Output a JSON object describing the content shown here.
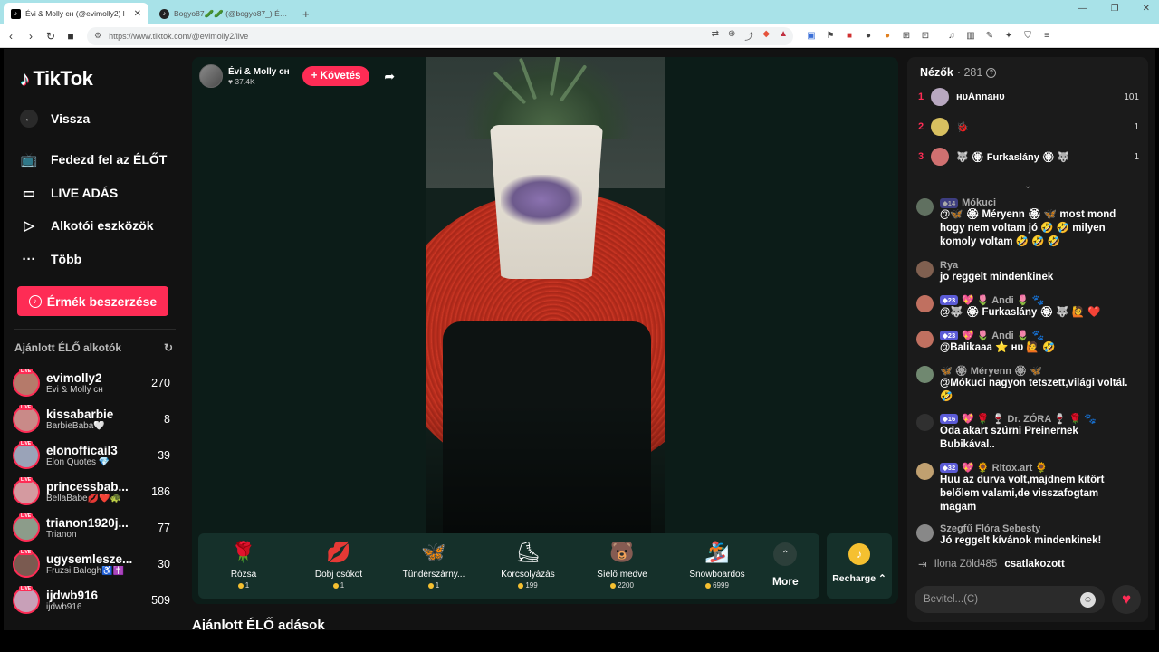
{
  "browser": {
    "tabs": [
      {
        "title": "Évi & Molly ᴄʜ (@evimolly2) l",
        "active": true
      },
      {
        "title": "Bogyo87🥒🥒 (@bogyo87_) ÉLŐ ad",
        "active": false
      }
    ],
    "url": "https://www.tiktok.com/@evimolly2/live"
  },
  "sidebar": {
    "logo": "TikTok",
    "back": "Vissza",
    "nav": [
      "Fedezd fel az ÉLŐT",
      "LIVE ADÁS",
      "Alkotói eszközök",
      "Több"
    ],
    "coins_button": "Érmék beszerzése",
    "recommended_title": "Ajánlott ÉLŐ alkotók",
    "live_badge": "LIVE",
    "creators": [
      {
        "name": "evimolly2",
        "sub": "Évi & Molly ᴄʜ",
        "count": "270",
        "color": "#b57a6a"
      },
      {
        "name": "kissabarbie",
        "sub": "BarbieBaba🤍",
        "count": "8",
        "color": "#c98a88"
      },
      {
        "name": "elonofficail3",
        "sub": "Elon Quotes 💎",
        "count": "39",
        "color": "#9aa3b8"
      },
      {
        "name": "princessbab...",
        "sub": "BellaBabe💋❤️🐢",
        "count": "186",
        "color": "#d49aa0"
      },
      {
        "name": "trianon1920j...",
        "sub": "Trianon",
        "count": "77",
        "color": "#8c9c8a"
      },
      {
        "name": "ugysemlesze...",
        "sub": "Fruzsi Balogh♿️✝️",
        "count": "30",
        "color": "#7a5a50"
      },
      {
        "name": "ijdwb916",
        "sub": "ijdwb916",
        "count": "509",
        "color": "#c8a0b8"
      }
    ]
  },
  "stream": {
    "host_name": "Évi & Molly ᴄʜ",
    "host_likes": "37.4K",
    "follow": "+ Követés",
    "gifts": [
      {
        "name": "Rózsa",
        "price": "1",
        "icon": "🌹"
      },
      {
        "name": "Dobj csókot",
        "price": "1",
        "icon": "💋"
      },
      {
        "name": "Tündérszárny...",
        "price": "1",
        "icon": "🦋"
      },
      {
        "name": "Korcsolyázás",
        "price": "199",
        "icon": "⛸"
      },
      {
        "name": "Síelő medve",
        "price": "2200",
        "icon": "🐻"
      },
      {
        "name": "Snowboardos",
        "price": "6999",
        "icon": "🏂"
      }
    ],
    "more": "More",
    "recharge": "Recharge"
  },
  "section_title": "Ajánlott ÉLŐ adások",
  "chat": {
    "viewers_label": "Nézők",
    "viewers_count": "· 281",
    "ranking": [
      {
        "rank": "1",
        "name": "нυAnnaнυ",
        "value": "101",
        "color": "#b8a8c0"
      },
      {
        "rank": "2",
        "name": "🐞",
        "value": "1",
        "color": "#d8c060"
      },
      {
        "rank": "3",
        "name": "🐺 🏵 Furkaslány 🏵 🐺",
        "value": "1",
        "color": "#d07070"
      }
    ],
    "messages": [
      {
        "badge": "14",
        "user": "Mókuci",
        "text": "@🦋 🏵 Méryenn 🏵 🦋 most mond hogy nem voltam jó 🤣 🤣 milyen komoly voltam 🤣 🤣 🤣",
        "color": "#607060",
        "faded": true
      },
      {
        "badge": "",
        "user": "Rya",
        "text": "jo reggelt mindenkinek",
        "color": "#806050"
      },
      {
        "badge": "23",
        "user": "💖 🌷 Andi 🌷 🐾",
        "text": "@🐺 🏵 Furkaslány 🏵 🐺 🙋 ❤️",
        "color": "#c07060"
      },
      {
        "badge": "23",
        "user": "💖 🌷 Andi 🌷 🐾",
        "text": "@Balikaaa ⭐ нυ 🙋 🤣",
        "color": "#c07060"
      },
      {
        "badge": "",
        "user": "🦋 🏵 Méryenn 🏵 🦋",
        "text": "@Mókuci nagyon tetszett,világi voltál. 🤣",
        "color": "#708870"
      },
      {
        "badge": "16",
        "user": "💖 🌹 🍷 Dr. ZÓRA 🍷 🌹 🐾",
        "text": "Oda akart szúrni Preinernek Bubikával..",
        "color": "#303030"
      },
      {
        "badge": "32",
        "user": "💖 🌻 Ritox.art 🌻",
        "text": "Huu az durva volt,majdnem kitört belőlem valami,de visszafogtam magam",
        "color": "#c0a070"
      },
      {
        "badge": "",
        "user": "Szegfű Flóra Sebesty",
        "text": "Jó reggelt kívánok mindenkinek!",
        "color": "#888888"
      }
    ],
    "join_user": "Ilona Zöld485",
    "join_text": "csatlakozott",
    "input_placeholder": "Bevitel...(C)"
  }
}
